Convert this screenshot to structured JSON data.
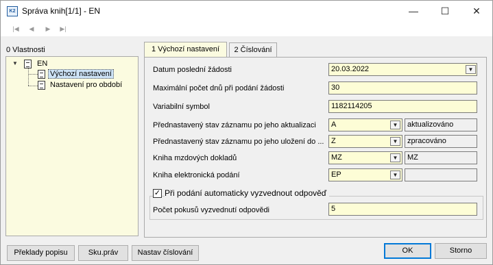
{
  "window": {
    "title": "Správa knih[1/1] - EN",
    "app_icon_text": "K2"
  },
  "titlebar_controls": {
    "minimize": "—",
    "maximize": "☐",
    "close": "✕"
  },
  "nav": {
    "first": "|◀",
    "prev": "◀",
    "next": "▶",
    "last": "▶|"
  },
  "left": {
    "header": "0 Vlastnosti",
    "tree": {
      "root": {
        "toggle": "▼",
        "label": "EN"
      },
      "children": [
        {
          "label": "Výchozí nastavení",
          "selected": true
        },
        {
          "label": "Nastavení pro období",
          "selected": false
        }
      ]
    }
  },
  "tabs": [
    {
      "label": "1 Výchozí nastavení",
      "active": true
    },
    {
      "label": "2 Číslování",
      "active": false
    }
  ],
  "form": {
    "rows": [
      {
        "label": "Datum poslední žádosti",
        "value": "20.03.2022",
        "dropdown": true,
        "desc": null
      },
      {
        "label": "Maximální počet dnů při podání žádosti",
        "value": "30",
        "dropdown": false,
        "desc": null
      },
      {
        "label": "Variabilní symbol",
        "value": "1182114205",
        "dropdown": false,
        "desc": null
      },
      {
        "label": "Přednastavený stav záznamu po jeho aktualizaci",
        "value": "A",
        "dropdown": true,
        "desc": "aktualizováno"
      },
      {
        "label": "Přednastavený stav záznamu po jeho uložení do ...",
        "value": "Z",
        "dropdown": true,
        "desc": "zpracováno"
      },
      {
        "label": "Kniha mzdových dokladů",
        "value": "MZ",
        "dropdown": true,
        "desc": "MZ"
      },
      {
        "label": "Kniha elektronická podání",
        "value": "EP",
        "dropdown": true,
        "desc": ""
      }
    ],
    "auto_pickup": {
      "checked": true,
      "check_mark": "✓",
      "label": "Při podání automaticky vyzvednout odpověď"
    },
    "attempts": {
      "label": "Počet pokusů vyzvednutí odpovědi",
      "value": "5"
    },
    "dropdown_glyph": "▼"
  },
  "buttons": {
    "translations": "Překlady popisu",
    "rights": "Sku.práv",
    "numbering": "Nastav číslování",
    "ok": "OK",
    "cancel": "Storno"
  },
  "colors": {
    "field_bg": "#fdfdd6",
    "tree_bg": "#fbfbe0",
    "accent": "#0078d7"
  }
}
